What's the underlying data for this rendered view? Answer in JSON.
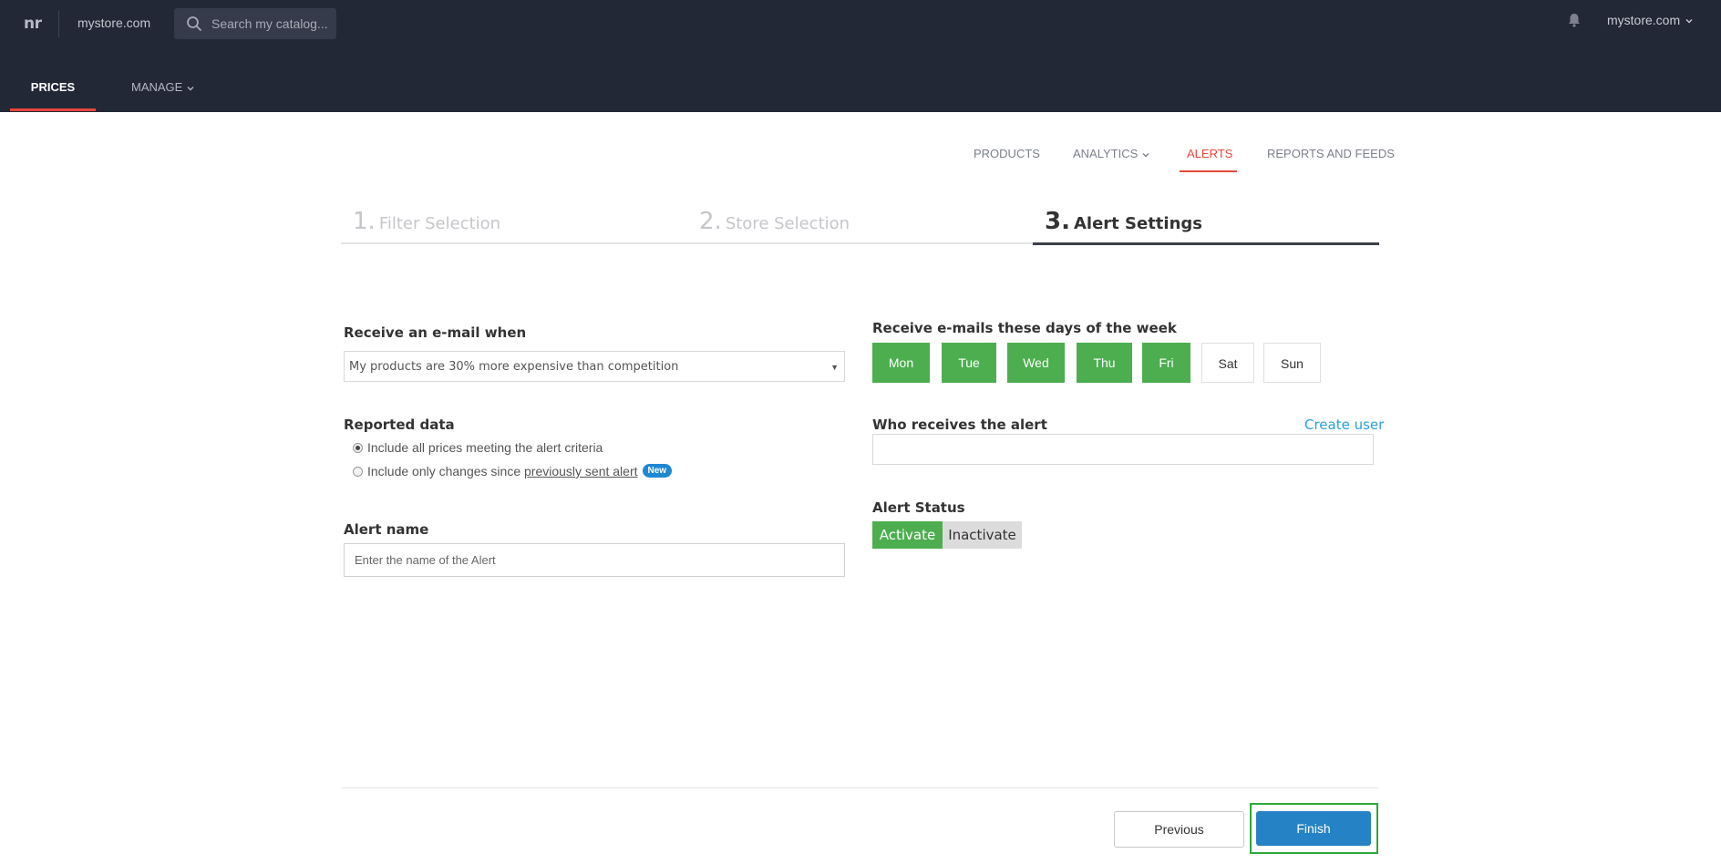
{
  "app": {
    "logo_text": "nr",
    "store_name": "mystore.com",
    "search_placeholder": "Search my catalog...",
    "account_label": "mystore.com"
  },
  "main_nav": {
    "prices": "PRICES",
    "manage": "MANAGE"
  },
  "sub_nav": {
    "products": "PRODUCTS",
    "analytics": "ANALYTICS",
    "alerts": "ALERTS",
    "reports": "REPORTS AND FEEDS"
  },
  "steps": [
    {
      "num": "1.",
      "label": "Filter Selection"
    },
    {
      "num": "2.",
      "label": "Store Selection"
    },
    {
      "num": "3.",
      "label": "Alert Settings"
    }
  ],
  "form": {
    "email_when_label": "Receive an e-mail when",
    "email_when_value": "My products are 30% more expensive than competition",
    "reported_label": "Reported data",
    "radio_all": "Include all prices meeting the alert criteria",
    "radio_changes_prefix": "Include only changes since ",
    "radio_changes_link": "previously sent alert",
    "new_badge": "New",
    "alert_name_label": "Alert name",
    "alert_name_placeholder": "Enter the name of the Alert",
    "days_label": "Receive e-mails these days of the week",
    "days": [
      {
        "label": "Mon",
        "selected": true
      },
      {
        "label": "Tue",
        "selected": true
      },
      {
        "label": "Wed",
        "selected": true
      },
      {
        "label": "Thu",
        "selected": true
      },
      {
        "label": "Fri",
        "selected": true
      },
      {
        "label": "Sat",
        "selected": false
      },
      {
        "label": "Sun",
        "selected": false
      }
    ],
    "who_label": "Who receives the alert",
    "create_user": "Create user",
    "status_label": "Alert Status",
    "activate": "Activate",
    "inactivate": "Inactivate"
  },
  "footer": {
    "previous": "Previous",
    "finish": "Finish"
  },
  "colors": {
    "topbar": "#232837",
    "accent_red": "#e8463c",
    "green": "#4cae4f",
    "finish_blue": "#2583c5"
  }
}
